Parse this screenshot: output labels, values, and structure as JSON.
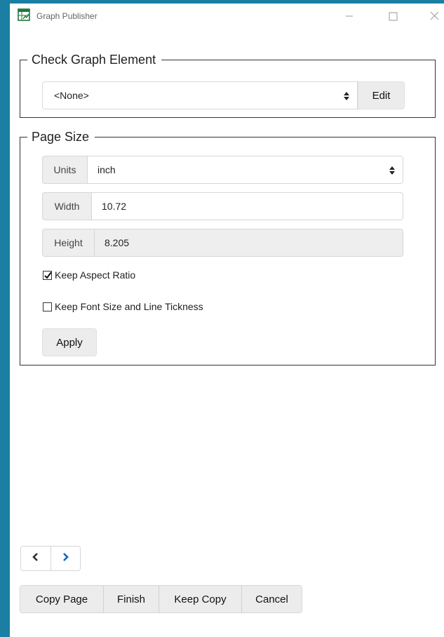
{
  "window": {
    "title": "Graph Publisher",
    "icon": "spreadsheet-graph-icon",
    "controls": [
      "minimize-icon",
      "maximize-icon",
      "close-icon"
    ]
  },
  "check_graph_element": {
    "legend": "Check Graph Element",
    "selected": "<None>",
    "edit_label": "Edit"
  },
  "page_size": {
    "legend": "Page Size",
    "units_label": "Units",
    "units_value": "inch",
    "width_label": "Width",
    "width_value": "10.72",
    "height_label": "Height",
    "height_value": "8.205",
    "keep_aspect_label": "Keep Aspect Ratio",
    "keep_aspect_checked": true,
    "keep_font_label": "Keep Font Size and Line Tickness",
    "keep_font_checked": false,
    "apply_label": "Apply"
  },
  "nav": {
    "prev_icon": "chevron-left-icon",
    "next_icon": "chevron-right-icon"
  },
  "actions": {
    "copy_page": "Copy Page",
    "finish": "Finish",
    "keep_copy": "Keep Copy",
    "cancel": "Cancel"
  },
  "colors": {
    "background": "#1a7fa3",
    "next_arrow": "#1565c0",
    "prev_arrow": "#333333"
  }
}
